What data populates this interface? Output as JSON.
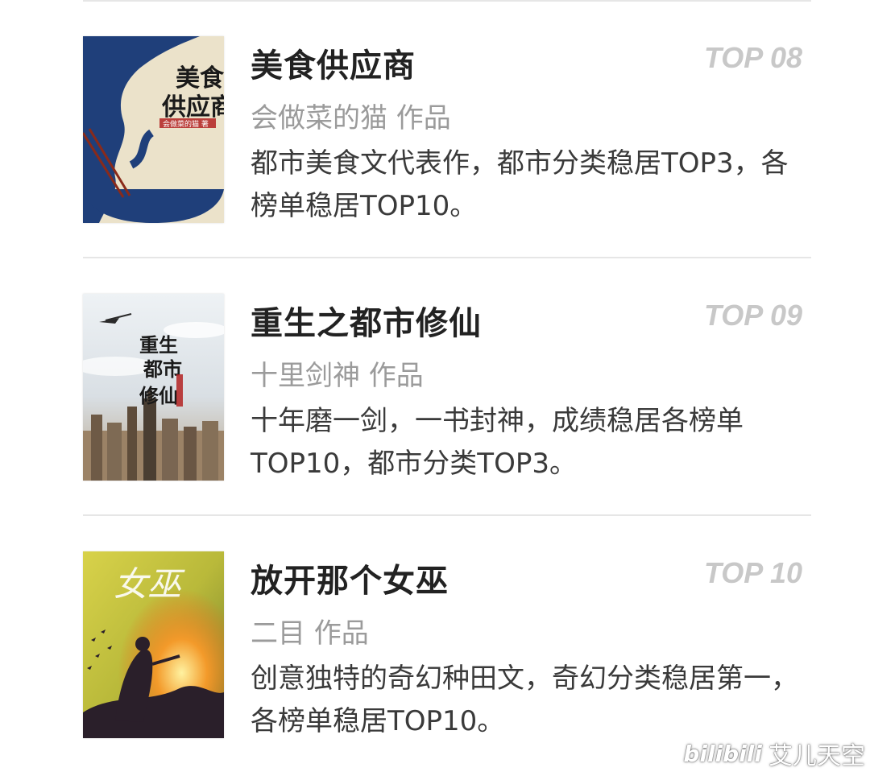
{
  "books": [
    {
      "title": "美食供应商",
      "rank": "TOP 08",
      "author": "会做菜的猫 作品",
      "description": "都市美食文代表作，都市分类稳居TOP3，各榜单稳居TOP10。",
      "cover_title": "美食供应商",
      "cover_author": "会做菜的猫 著",
      "cover_colors": {
        "background": "#efe6d0",
        "accent": "#1f3f7a",
        "stamp": "#b32222"
      }
    },
    {
      "title": "重生之都市修仙",
      "rank": "TOP 09",
      "author": "十里剑神 作品",
      "description": "十年磨一剑，一书封神，成绩稳居各榜单TOP10，都市分类TOP3。",
      "cover_title": "重生都市修仙",
      "cover_colors": {
        "background": "#dfe6ec",
        "accent": "#2a2a2a",
        "city": "#8a6a4a"
      }
    },
    {
      "title": "放开那个女巫",
      "rank": "TOP 10",
      "author": "二目 作品",
      "description": "创意独特的奇幻种田文，奇幻分类稳居第一，各榜单稳居TOP10。",
      "cover_title": "女巫",
      "cover_colors": {
        "background": "#c9c23a",
        "accent": "#e86a1a",
        "dark": "#2a1f2a"
      }
    }
  ],
  "watermark": {
    "logo": "bilibili",
    "text": "艾儿天空"
  },
  "colors": {
    "title": "#222222",
    "rank": "#c8c8c8",
    "author": "#9b9b9b",
    "description": "#3a3a3a",
    "divider": "#e6e6e6"
  }
}
